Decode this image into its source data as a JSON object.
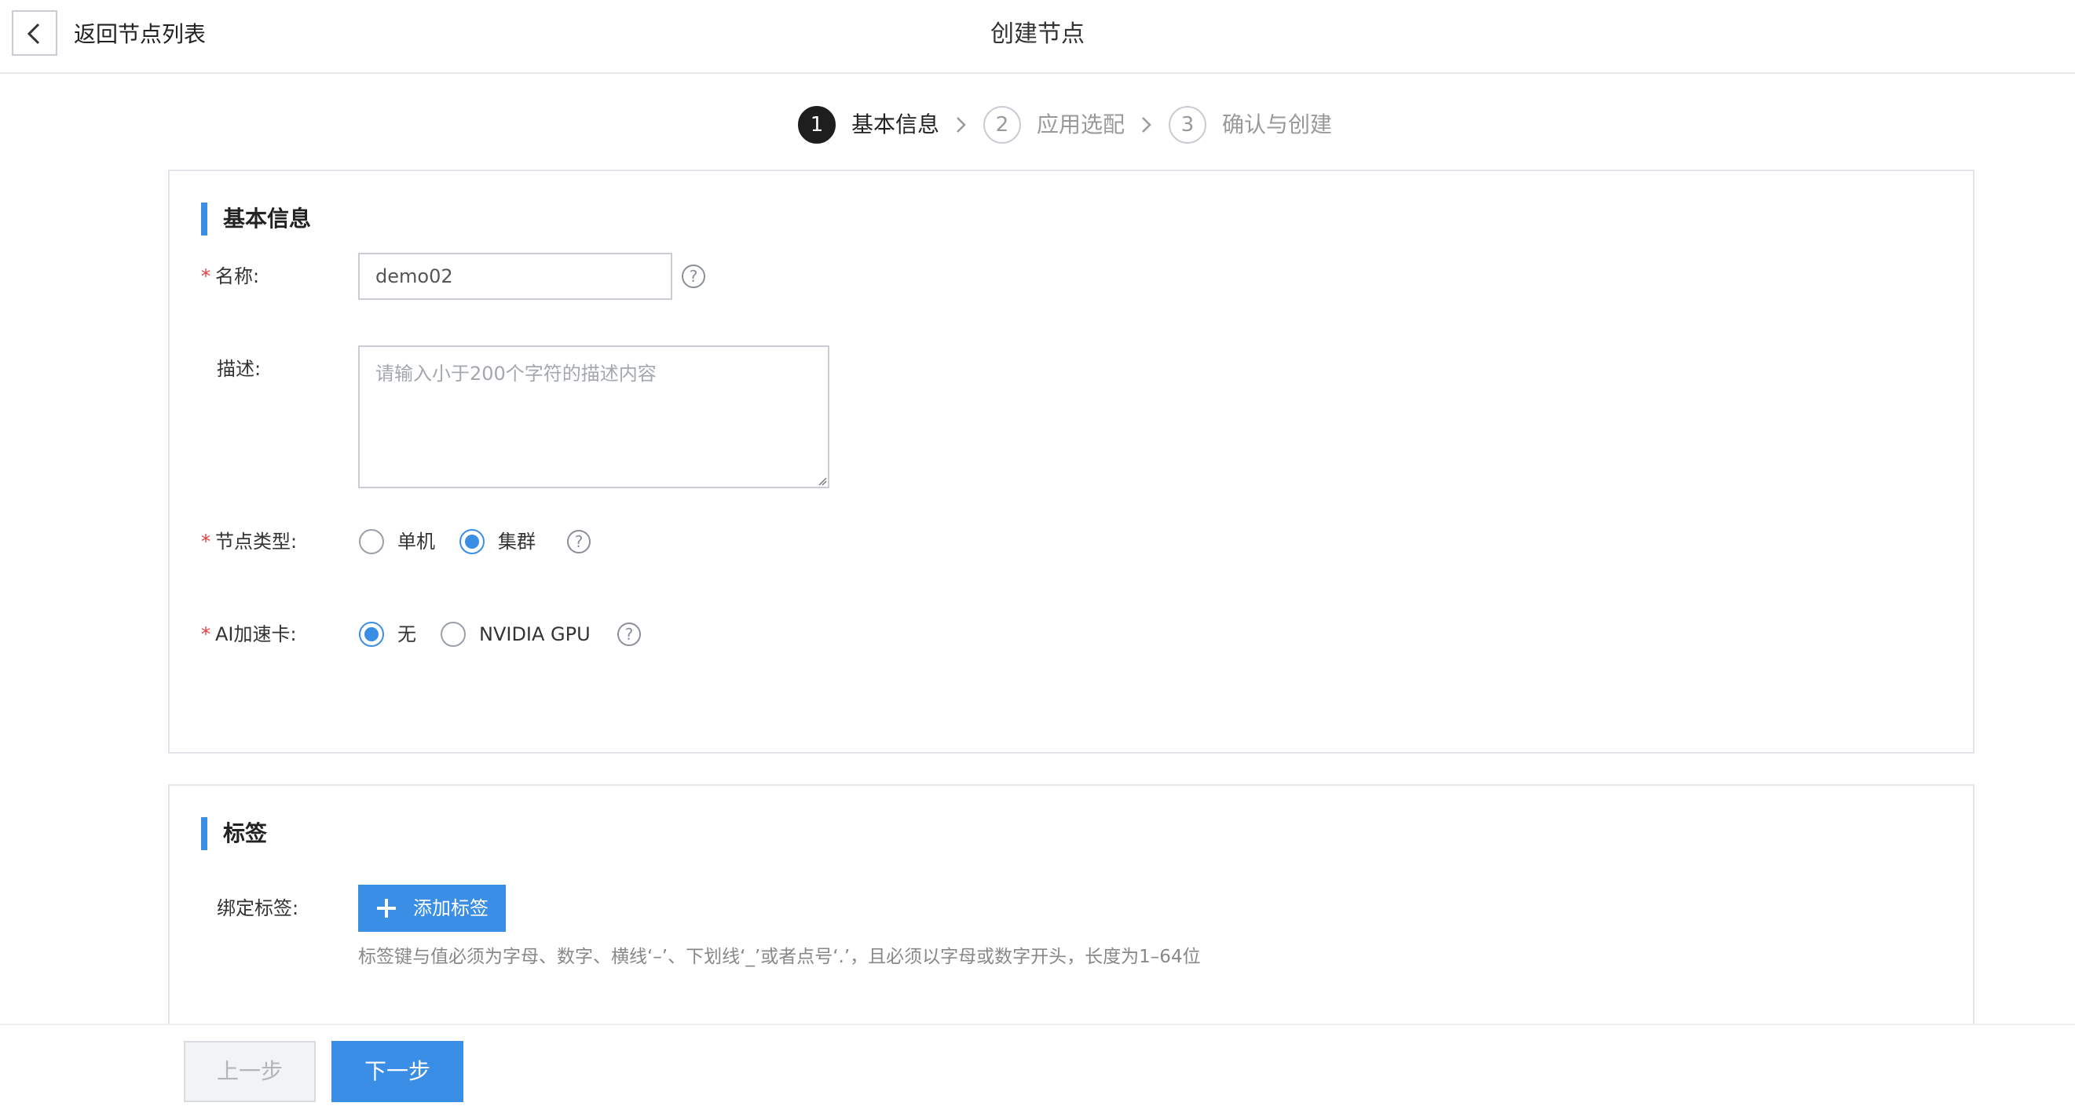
{
  "header": {
    "back_label": "返回节点列表",
    "title": "创建节点"
  },
  "steps": [
    {
      "number": "1",
      "label": "基本信息",
      "active": true
    },
    {
      "number": "2",
      "label": "应用选配",
      "active": false
    },
    {
      "number": "3",
      "label": "确认与创建",
      "active": false
    }
  ],
  "basic_info": {
    "title": "基本信息",
    "name": {
      "label": "名称:",
      "value": "demo02",
      "required": true
    },
    "description": {
      "label": "描述:",
      "value": "",
      "placeholder": "请输入小于200个字符的描述内容",
      "required": false
    },
    "node_type": {
      "label": "节点类型:",
      "required": true,
      "options": [
        {
          "label": "单机",
          "checked": false
        },
        {
          "label": "集群",
          "checked": true
        }
      ]
    },
    "ai_accelerator": {
      "label": "AI加速卡:",
      "required": true,
      "options": [
        {
          "label": "无",
          "checked": true
        },
        {
          "label": "NVIDIA GPU",
          "checked": false
        }
      ]
    },
    "help_symbol": "?"
  },
  "tags": {
    "title": "标签",
    "bind_label": "绑定标签:",
    "add_button": "添加标签",
    "hint": "标签键与值必须为字母、数字、横线‘–’、下划线‘_’或者点号‘.’，且必须以字母或数字开头，长度为1–64位"
  },
  "footer": {
    "prev_label": "上一步",
    "next_label": "下一步"
  },
  "required_mark": "*",
  "colors": {
    "accent": "#3b8ee5",
    "required": "#e53e3e",
    "active_step": "#1e1e1e"
  }
}
